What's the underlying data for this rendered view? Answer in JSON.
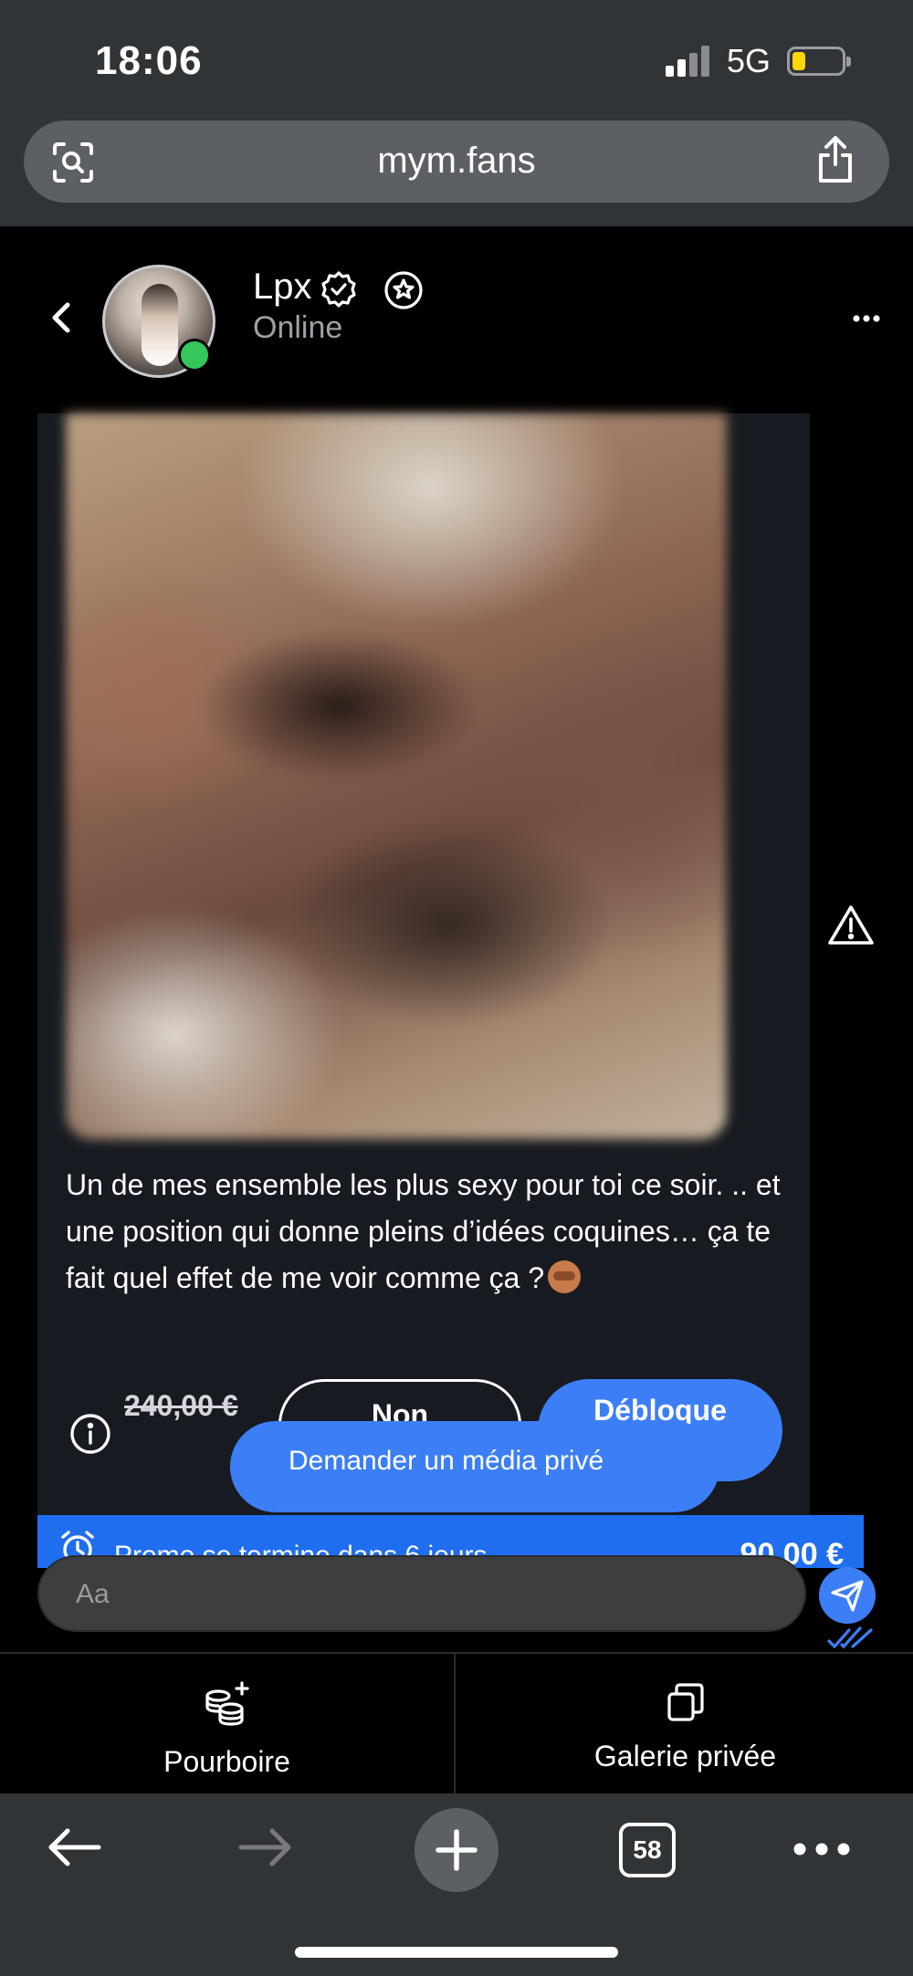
{
  "status_bar": {
    "time": "18:06",
    "network": "5G",
    "battery_level": 0.2
  },
  "browser": {
    "url": "mym.fans",
    "tab_count": "58"
  },
  "chat": {
    "contact_name": "Lpx",
    "presence": "Online"
  },
  "message": {
    "text": "Un de mes ensemble les plus sexy pour toi ce soir. .. et une position qui donne pleins d’idées coquines… ça te fait quel effet de me voir comme ça ?",
    "emoji": "🙈",
    "old_price": "240,00 €",
    "decline_label": "Non",
    "unlock_label": "Débloque",
    "request_label": "Demander un média privé"
  },
  "promo": {
    "text": "Promo se termine dans 6 jours",
    "price": "90,00 €"
  },
  "composer": {
    "placeholder": "Aa"
  },
  "tabs": {
    "tip_label": "Pourboire",
    "gallery_label": "Galerie privée"
  },
  "colors": {
    "accent": "#3c7ef5",
    "online": "#34c759",
    "battery": "#ffd60a",
    "card_bg": "#171b21",
    "browser_chrome": "#313437"
  },
  "icons": [
    "back-icon",
    "verified-icon",
    "star-icon",
    "more-icon",
    "warning-icon",
    "info-icon",
    "alarm-icon",
    "send-icon",
    "double-check-icon",
    "tip-coins-icon",
    "gallery-icon",
    "lens-icon",
    "share-icon",
    "arrow-left-icon",
    "arrow-right-icon",
    "plus-icon",
    "ellipsis-icon"
  ]
}
